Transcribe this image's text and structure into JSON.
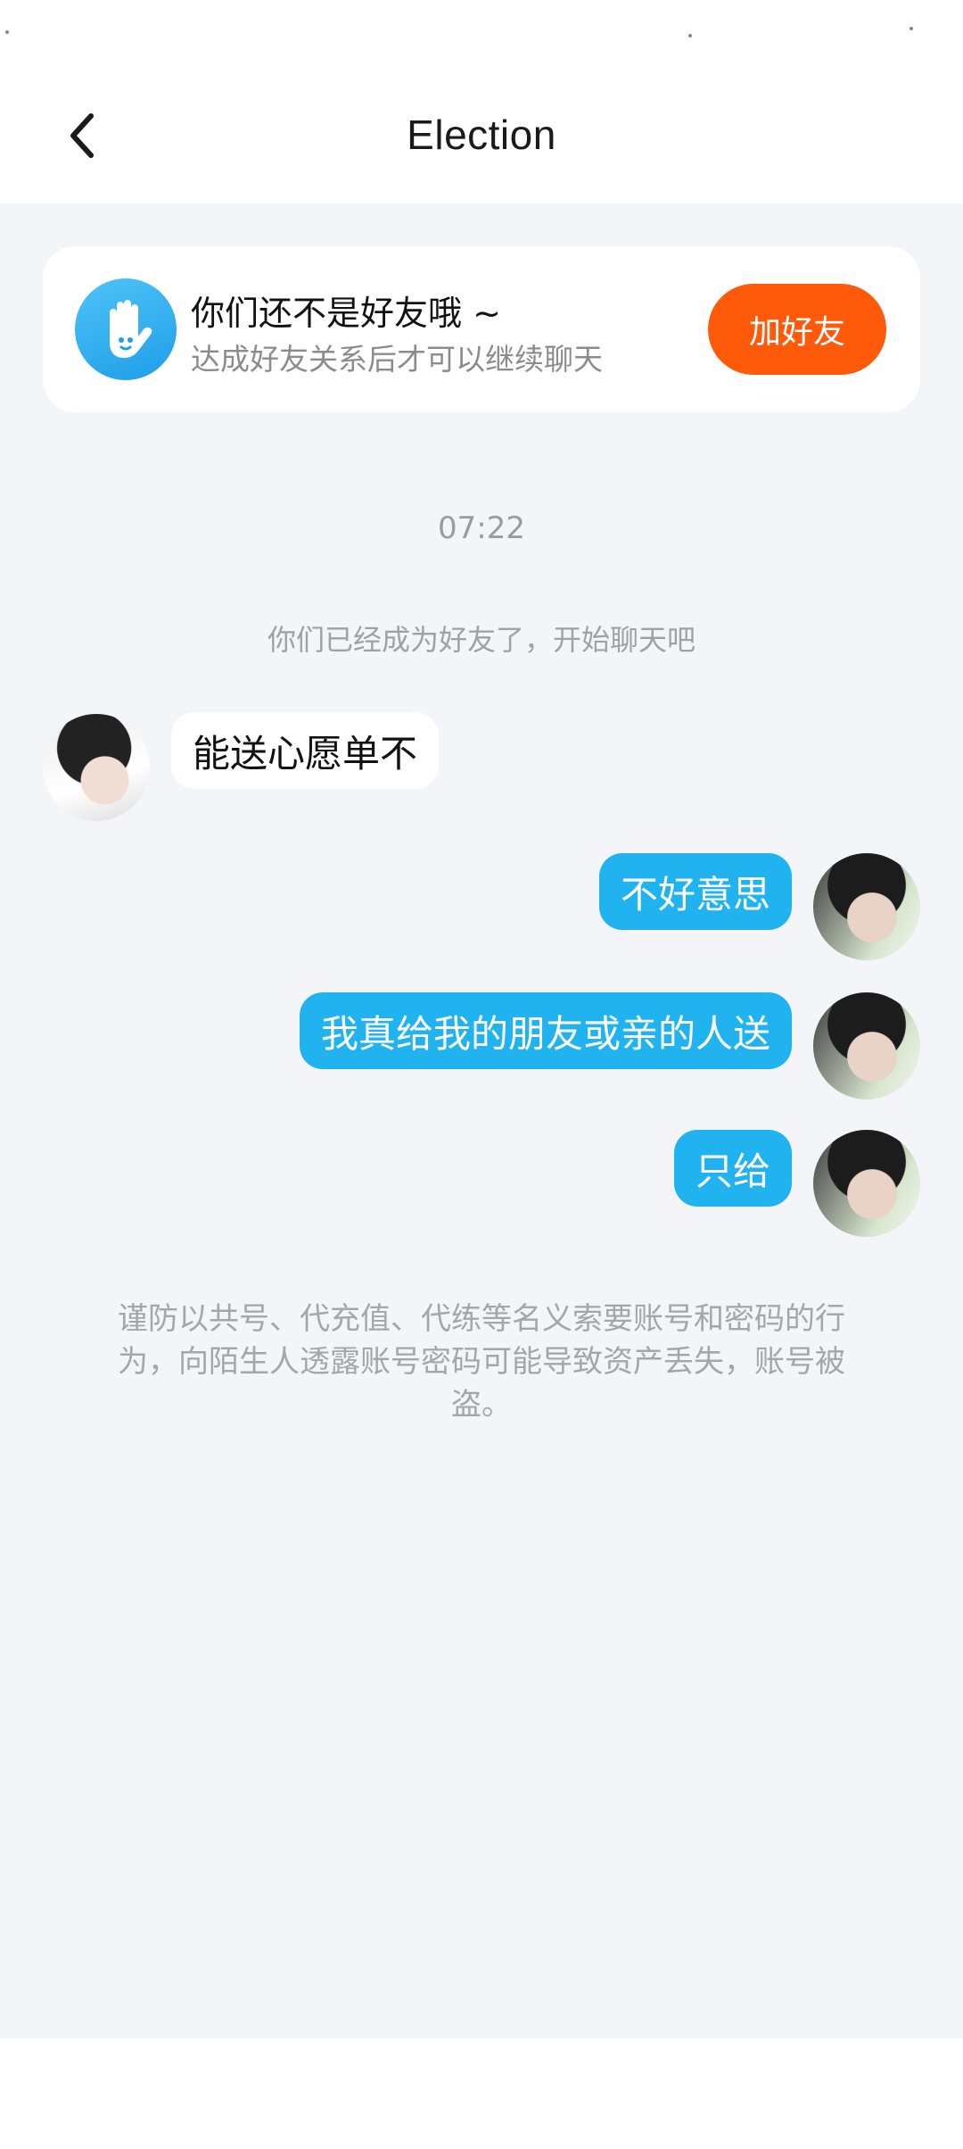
{
  "header": {
    "title": "Election",
    "back_icon": "chevron-left-icon"
  },
  "friend_banner": {
    "icon": "hand-icon",
    "title": "你们还不是好友哦 ~",
    "subtitle": "达成好友关系后才可以继续聊天",
    "button_label": "加好友",
    "button_color": "#ff5a0a"
  },
  "chat": {
    "timestamp": "07:22",
    "system_notice": "你们已经成为好友了，开始聊天吧",
    "messages": [
      {
        "side": "left",
        "text": "能送心愿单不"
      },
      {
        "side": "right",
        "text": "不好意思"
      },
      {
        "side": "right",
        "text": "我真给我的朋友或亲的人送"
      },
      {
        "side": "right",
        "text": "只给"
      }
    ],
    "outgoing_color": "#20b3f0",
    "warning": "谨防以共号、代充值、代练等名义索要账号和密码的行为，向陌生人透露账号密码可能导致资产丢失，账号被盗。"
  }
}
